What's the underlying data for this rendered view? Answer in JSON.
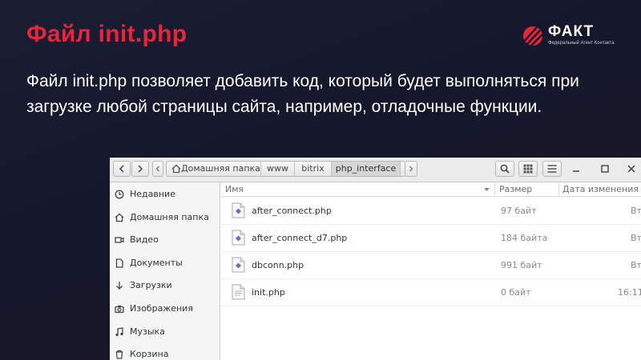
{
  "slide": {
    "title": "Файл init.php",
    "body": "Файл init.php позволяет добавить код, который будет выполняться при загрузке любой страницы сайта, например, отладочные функции.",
    "logo": {
      "word": "ФАКТ",
      "tagline": "Федеральный Агент Контакта"
    }
  },
  "file_manager": {
    "breadcrumbs": [
      {
        "label": "Домашняя папка",
        "icon": "home-icon"
      },
      {
        "label": "www"
      },
      {
        "label": "bitrix"
      },
      {
        "label": "php_interface",
        "active": true
      }
    ],
    "sidebar": {
      "items": [
        {
          "label": "Недавние",
          "icon": "clock-icon"
        },
        {
          "label": "Домашняя папка",
          "icon": "home-icon"
        },
        {
          "label": "Видео",
          "icon": "video-icon"
        },
        {
          "label": "Документы",
          "icon": "document-icon"
        },
        {
          "label": "Загрузки",
          "icon": "download-icon"
        },
        {
          "label": "Изображения",
          "icon": "camera-icon"
        },
        {
          "label": "Музыка",
          "icon": "music-icon"
        },
        {
          "label": "Корзина",
          "icon": "trash-icon"
        }
      ]
    },
    "columns": {
      "name": "Имя",
      "size": "Размер",
      "date": "Дата изменения"
    },
    "files": [
      {
        "name": "after_connect.php",
        "size": "97 байт",
        "date": "Вт",
        "icon": "php-file-icon"
      },
      {
        "name": "after_connect_d7.php",
        "size": "184 байта",
        "date": "Вт",
        "icon": "php-file-icon"
      },
      {
        "name": "dbconn.php",
        "size": "991 байт",
        "date": "Вт",
        "icon": "php-file-icon"
      },
      {
        "name": "init.php",
        "size": "0 байт",
        "date": "16:11",
        "icon": "text-file-icon"
      }
    ]
  },
  "colors": {
    "title_red": "#e8243a",
    "background": "#16182b",
    "accent_diamond": "#8a5fb5"
  }
}
